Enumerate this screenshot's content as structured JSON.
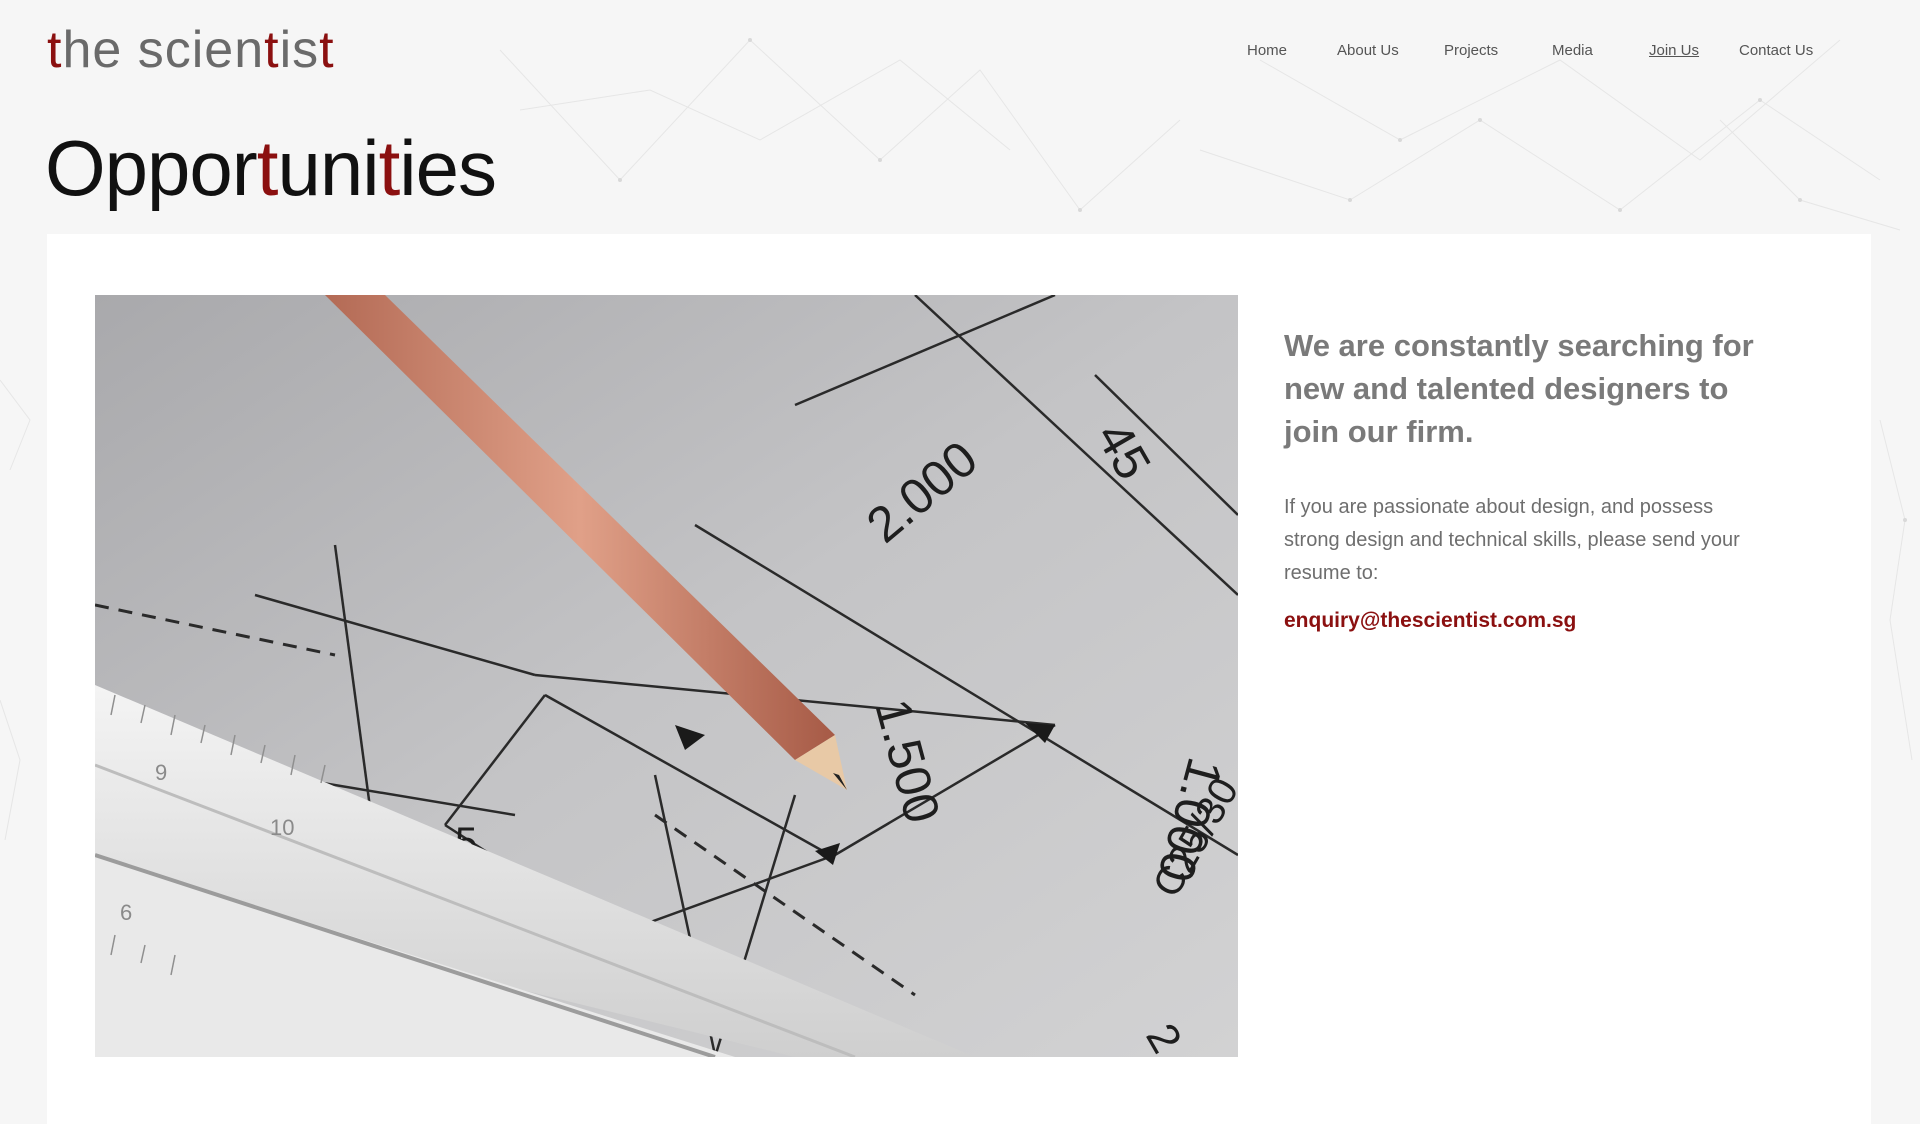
{
  "brand": {
    "logo_parts": [
      "t",
      "he scien",
      "t",
      "is",
      "t"
    ],
    "accent_color": "#8b1010"
  },
  "nav": {
    "items": [
      {
        "label": "Home",
        "active": false
      },
      {
        "label": "About Us",
        "active": false
      },
      {
        "label": "Projects",
        "active": false
      },
      {
        "label": "Media",
        "active": false
      },
      {
        "label": "Join Us",
        "active": true
      },
      {
        "label": "Contact Us",
        "active": false
      }
    ]
  },
  "page": {
    "title_parts": [
      "Oppor",
      "t",
      "uni",
      "t",
      "ies"
    ]
  },
  "hero_image": {
    "icon": "architectural-drawing-with-pencil-and-scale-ruler",
    "drawing_labels": [
      "2.000",
      "1.500",
      "1.000",
      "45",
      "55",
      "C25/30",
      "5",
      "9",
      "6",
      "10",
      "2"
    ]
  },
  "content": {
    "headline": "We are constantly searching for new and talented designers to join our firm.",
    "body": "If you are passionate about design, and possess strong design and technical skills, please send your resume to:",
    "email": "enquiry@thescientist.com.sg"
  }
}
